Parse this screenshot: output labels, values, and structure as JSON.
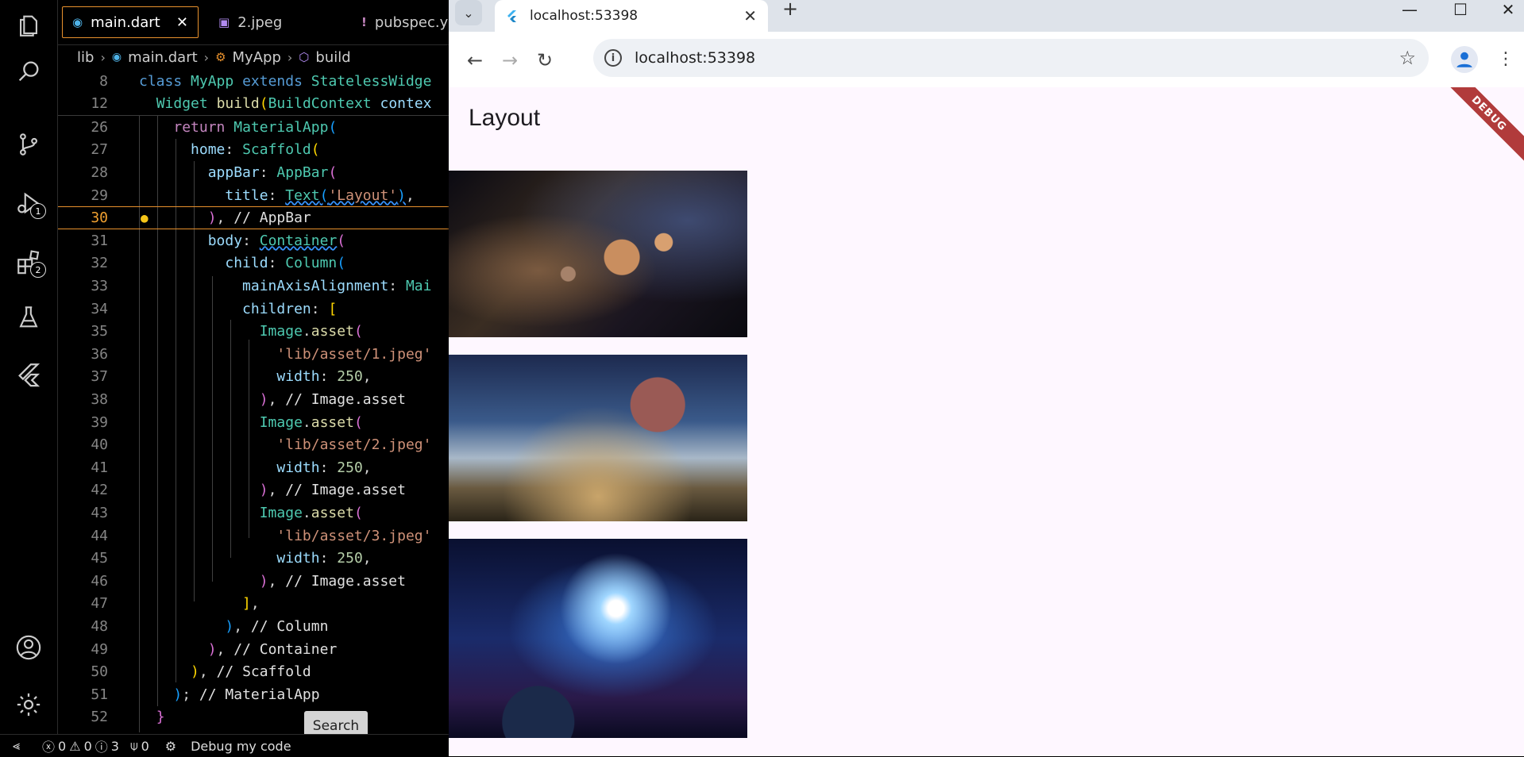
{
  "vscode": {
    "activity_bar": {
      "items": [
        {
          "icon": "explorer-icon"
        },
        {
          "icon": "search-icon"
        },
        {
          "icon": "source-control-icon"
        },
        {
          "icon": "run-debug-icon",
          "badge": "1"
        },
        {
          "icon": "extensions-icon",
          "badge": "2"
        },
        {
          "icon": "testing-icon"
        },
        {
          "icon": "flutter-icon"
        },
        {
          "icon": "account-icon"
        },
        {
          "icon": "settings-gear-icon"
        }
      ]
    },
    "tabs": [
      {
        "label": "main.dart",
        "icon": "dart-icon",
        "close": "✕"
      },
      {
        "label": "2.jpeg",
        "icon": "image-icon"
      },
      {
        "label": "pubspec.y",
        "icon": "yaml-icon"
      }
    ],
    "breadcrumb": [
      "lib",
      "main.dart",
      "MyApp",
      "build"
    ],
    "hover_button": "Search",
    "statusbar": {
      "errors": "0",
      "warnings": "0",
      "infos": "3",
      "ports": "0",
      "debug_label": "Debug my code"
    }
  },
  "browser": {
    "tab_title": "localhost:53398",
    "url": "localhost:53398",
    "new_tab": "+",
    "app": {
      "appbar_title": "Layout",
      "debug_banner": "DEBUG",
      "images": [
        "lib/asset/1.jpeg",
        "lib/asset/2.jpeg",
        "lib/asset/3.jpeg"
      ]
    }
  },
  "colors": {
    "accent_orange": "#e8912d",
    "debug_banner": "#b13b3b",
    "app_background": "#fef7ff"
  }
}
